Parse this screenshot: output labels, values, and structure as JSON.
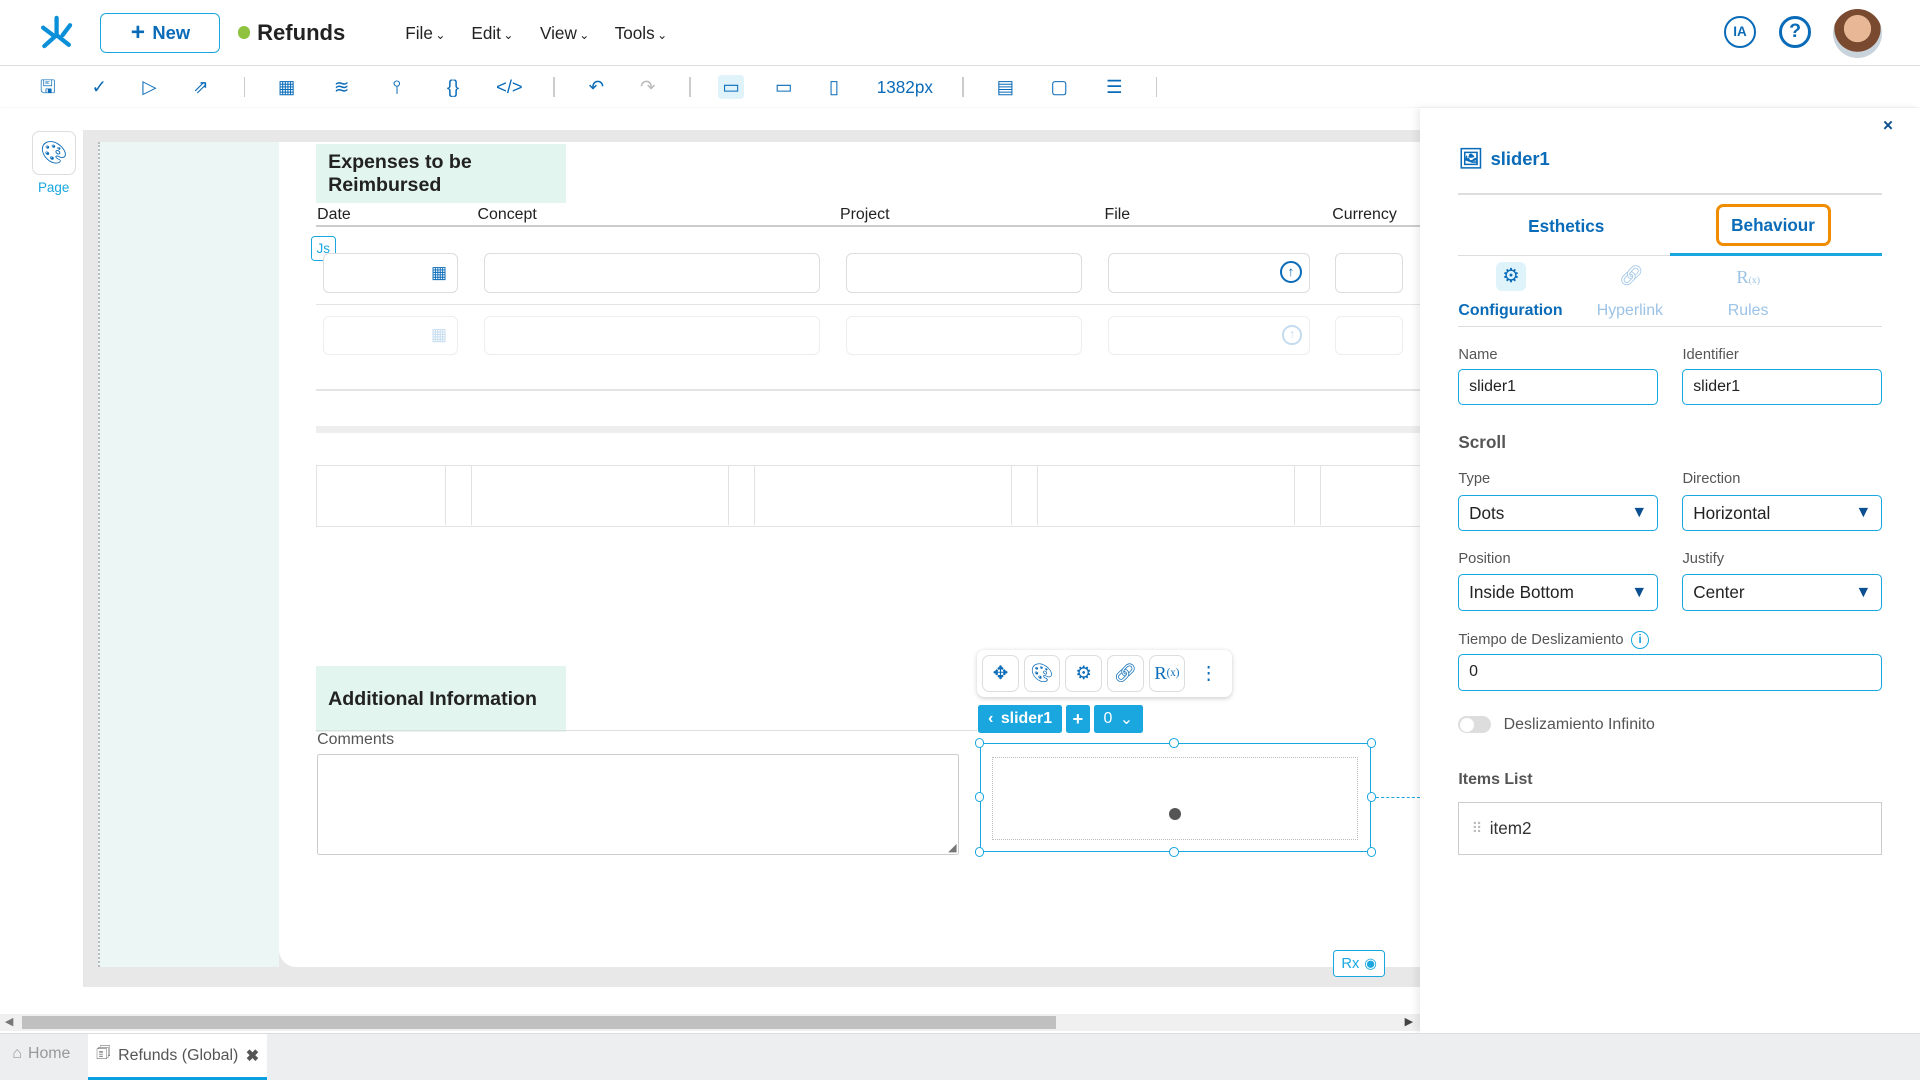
{
  "header": {
    "new_label": "New",
    "app_title": "Refunds",
    "status_color": "#8fc23f",
    "menus": [
      "File",
      "Edit",
      "View",
      "Tools"
    ],
    "ia_label": "IA"
  },
  "toolbar": {
    "width_readout": "1382px"
  },
  "left": {
    "page_label": "Page"
  },
  "canvas": {
    "section1_title": "Expenses to be Reimbursed",
    "columns": [
      "Date",
      "Concept",
      "Project",
      "File",
      "Currency"
    ],
    "js_badge": "Js",
    "section2_title": "Additional Information",
    "comments_label": "Comments",
    "slider_chip": "slider1",
    "slider_index": "0",
    "rx_label": "Rx"
  },
  "panel": {
    "component_name": "slider1",
    "tabs": [
      "Esthetics",
      "Behaviour"
    ],
    "active_tab": "Behaviour",
    "subtabs": [
      "Configuration",
      "Hyperlink",
      "Rules"
    ],
    "name_label": "Name",
    "name_value": "slider1",
    "identifier_label": "Identifier",
    "identifier_value": "slider1",
    "scroll_heading": "Scroll",
    "type_label": "Type",
    "type_value": "Dots",
    "direction_label": "Direction",
    "direction_value": "Horizontal",
    "position_label": "Position",
    "position_value": "Inside Bottom",
    "justify_label": "Justify",
    "justify_value": "Center",
    "tiempo_label": "Tiempo de Deslizamiento",
    "tiempo_value": "0",
    "infinite_label": "Deslizamiento Infinito",
    "infinite_on": false,
    "items_heading": "Items List",
    "items": [
      "item2"
    ]
  },
  "bottom_tabs": {
    "home": "Home",
    "active": "Refunds (Global)"
  },
  "colors": {
    "accent": "#1aa7e0",
    "primary": "#0a6bb8",
    "highlight": "#f08c00"
  }
}
